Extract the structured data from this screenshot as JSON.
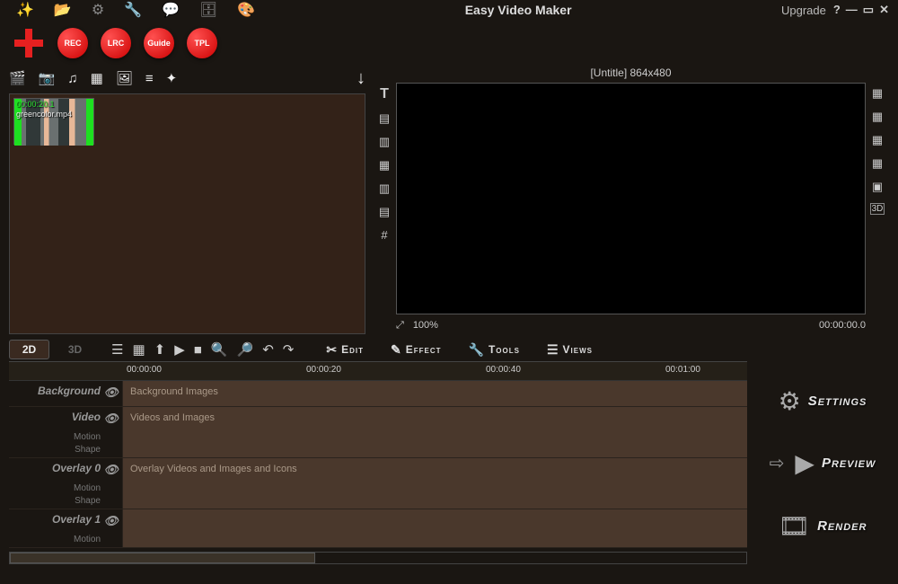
{
  "title": "Easy Video Maker",
  "upgrade": "Upgrade",
  "round_buttons": [
    "REC",
    "LRC",
    "Guide",
    "TPL"
  ],
  "preview": {
    "title": "[Untitle] 864x480",
    "zoom": "100%",
    "time": "00:00:00.0"
  },
  "clip": {
    "duration": "00:00:20.1",
    "name": "greencolor.mp4"
  },
  "mode_tabs": {
    "active": "2D",
    "inactive": "3D"
  },
  "mid_menus": [
    "Edit",
    "Effect",
    "Tools",
    "Views"
  ],
  "ruler": [
    "00:00:00",
    "00:00:20",
    "00:00:40",
    "00:01:00"
  ],
  "tracks": {
    "background": {
      "label": "Background",
      "hint": "Background Images"
    },
    "video": {
      "label": "Video",
      "hint": "Videos and Images",
      "sub1": "Motion",
      "sub2": "Shape"
    },
    "overlay0": {
      "label": "Overlay 0",
      "hint": "Overlay Videos and Images and Icons",
      "sub1": "Motion",
      "sub2": "Shape"
    },
    "overlay1": {
      "label": "Overlay 1",
      "sub1": "Motion"
    }
  },
  "actions": {
    "settings": "Settings",
    "preview": "Preview",
    "render": "Render"
  }
}
